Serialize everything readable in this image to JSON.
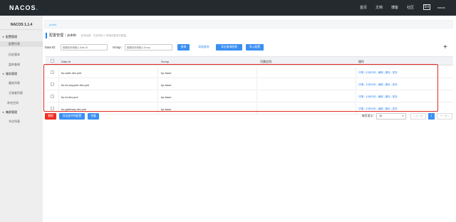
{
  "brand": {
    "logo_text": "NACOS",
    "logo_dot": "."
  },
  "topnav": [
    "首页",
    "文档",
    "博客",
    "社区",
    "En",
    "nacos"
  ],
  "sidebar": {
    "title": "NACOS 1.1.4",
    "items": [
      {
        "label": "配置管理",
        "type": "group"
      },
      {
        "label": "配置列表",
        "type": "sub",
        "active": true
      },
      {
        "label": "历史版本",
        "type": "sub"
      },
      {
        "label": "监听查询",
        "type": "sub"
      },
      {
        "label": "服务管理",
        "type": "group"
      },
      {
        "label": "服务列表",
        "type": "sub"
      },
      {
        "label": "订阅者列表",
        "type": "sub"
      },
      {
        "label": "命名空间",
        "type": "plain"
      },
      {
        "label": "集群管理",
        "type": "group"
      },
      {
        "label": "节点列表",
        "type": "sub"
      }
    ]
  },
  "namespace": {
    "link": "public"
  },
  "breadcrumb": {
    "title": "配置管理",
    "sep": "|",
    "ns": "public",
    "hint": "查询结果：共查询到 4 条满足要求的配置。"
  },
  "filters": {
    "data_id_label": "Data ID:",
    "data_id_placeholder": "模糊查询请输入Data ID",
    "group_label": "Group:",
    "group_placeholder": "模糊查询请输入Group",
    "search_label": "查询",
    "advanced_label": "高级查询",
    "export_query_label": "导出查询结果",
    "import_label": "导入配置"
  },
  "table": {
    "headers": [
      "Data Id",
      "Group",
      "归属应用:",
      "操作"
    ],
    "rows": [
      {
        "data_id": "bs-auth-dev.yml",
        "group": "bp-base",
        "app": ""
      },
      {
        "data_id": "bs-bz-support-dev.yml",
        "group": "bp-base",
        "app": ""
      },
      {
        "data_id": "bs-bi-dev.yml",
        "group": "bp-base",
        "app": ""
      },
      {
        "data_id": "bs-gateway-dev.yml",
        "group": "bp-base",
        "app": ""
      }
    ],
    "actions": [
      "详情",
      "示例代码",
      "编辑",
      "删除",
      "更多"
    ]
  },
  "footer": {
    "delete_label": "删除",
    "export_selected_label": "导出选中的配置",
    "clone_label": "克隆",
    "page_size_label": "每页显示：",
    "page_size_value": "10",
    "prev_label": "< 上一页",
    "page_current": "1",
    "next_label": "下一页 >"
  },
  "colors": {
    "accent": "#3b8ff3",
    "danger": "#ef2e23",
    "topbar": "#252a2f",
    "highlight": "#e32a22"
  }
}
